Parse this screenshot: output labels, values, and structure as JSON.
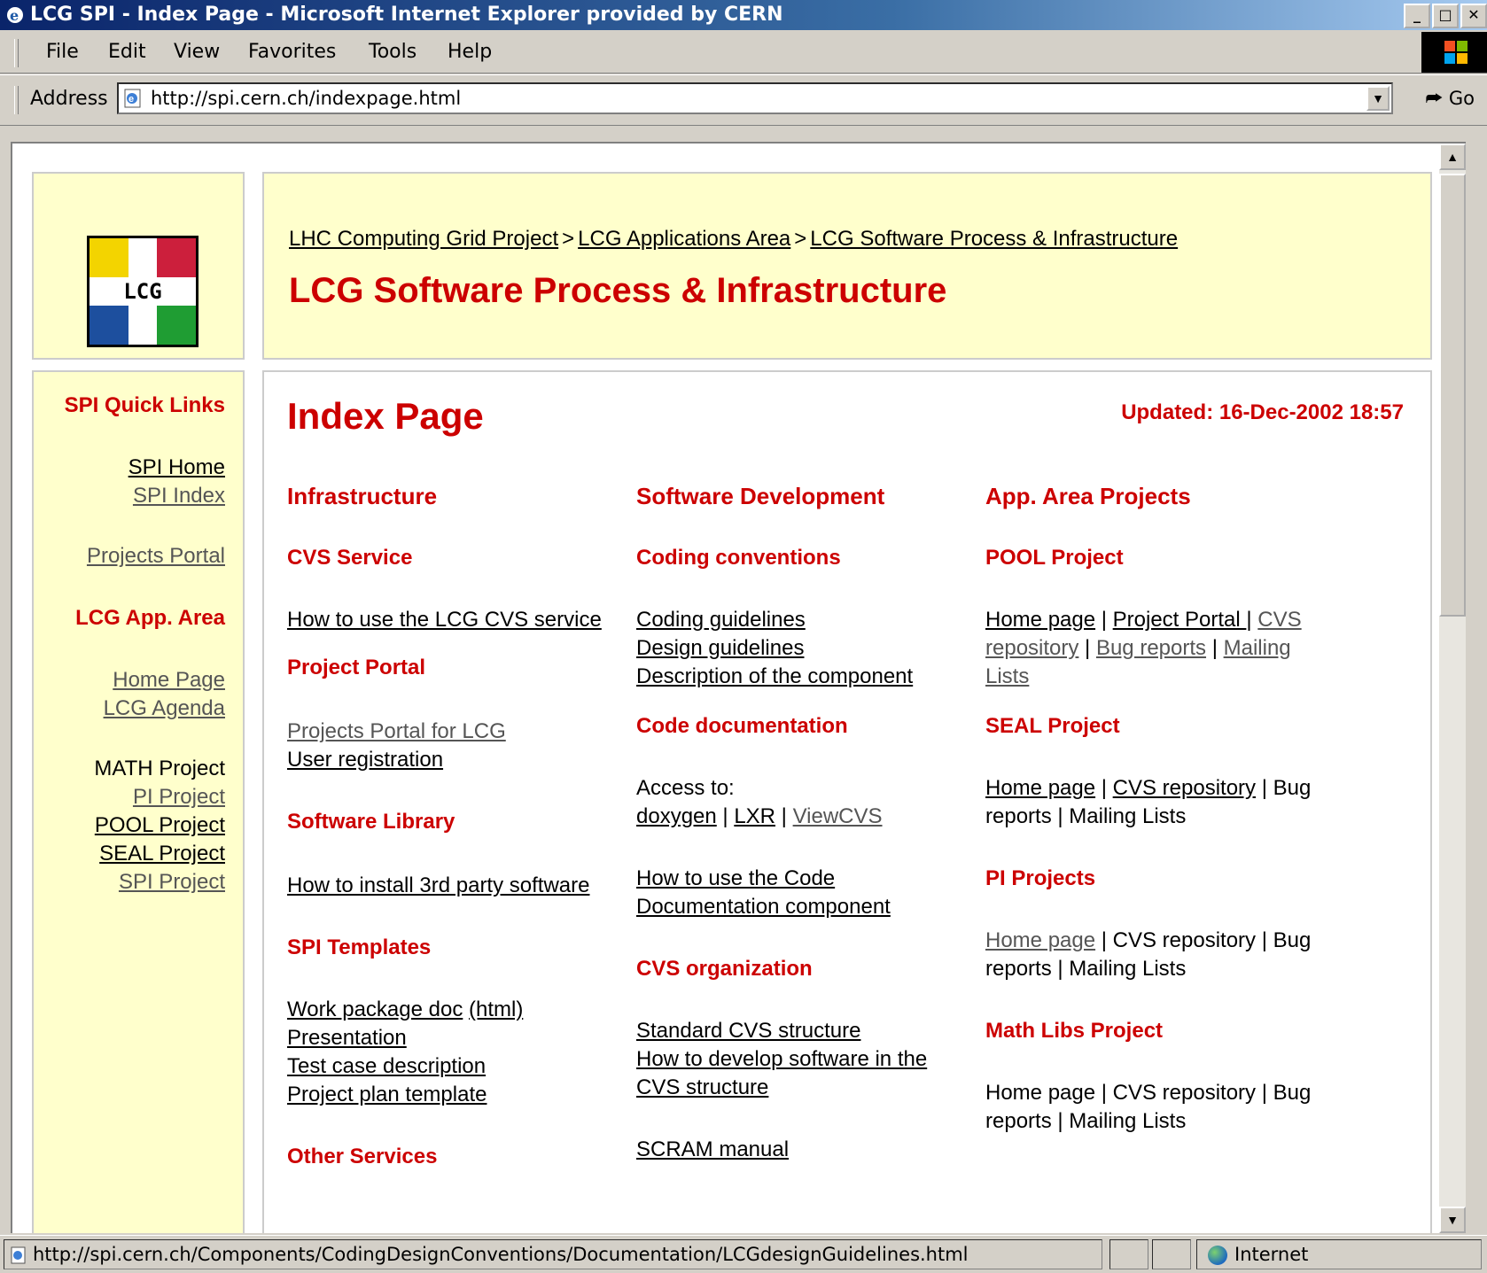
{
  "window": {
    "title": "LCG SPI - Index Page - Microsoft Internet Explorer provided by CERN",
    "min": "_",
    "max": "□",
    "close": "✕"
  },
  "menu": [
    "File",
    "Edit",
    "View",
    "Favorites",
    "Tools",
    "Help"
  ],
  "address": {
    "label": "Address",
    "url": "http://spi.cern.ch/indexpage.html",
    "go": "Go"
  },
  "header": {
    "breadcrumb": [
      "LHC Computing Grid Project",
      "LCG Applications Area",
      "LCG Software Process & Infrastructure"
    ],
    "separator": ">",
    "title": "LCG Software Process & Infrastructure",
    "logo_text": "LCG"
  },
  "sidebar": {
    "quick_links_heading": "SPI Quick Links",
    "spi_home": "SPI Home",
    "spi_index": "SPI Index",
    "projects_portal": "Projects Portal",
    "app_area_heading": "LCG App. Area",
    "home_page": "Home Page",
    "lcg_agenda": "LCG Agenda",
    "math_project": "MATH Project",
    "pi_project": "PI Project",
    "pool_project": "POOL Project",
    "seal_project": "SEAL Project",
    "spi_project": "SPI Project"
  },
  "main": {
    "title": "Index Page",
    "updated": "Updated: 16-Dec-2002 18:57",
    "col1": {
      "heading": "Infrastructure",
      "cvs_heading": "CVS Service",
      "cvs_link": "How to use the LCG CVS service",
      "portal_heading": "Project Portal",
      "portal_link1": "Projects Portal for LCG",
      "portal_link2": "User registration",
      "library_heading": "Software Library",
      "library_link": "How to install 3rd party software",
      "templates_heading": "SPI Templates",
      "tpl_work": "Work package doc",
      "tpl_html": "(html)",
      "tpl_presentation": "Presentation",
      "tpl_testcase": "Test case description",
      "tpl_plan": "Project plan template",
      "other_heading": "Other Services"
    },
    "col2": {
      "heading": "Software Development",
      "coding_heading": "Coding conventions",
      "coding_link1": "Coding guidelines",
      "coding_link2": "Design guidelines",
      "coding_link3": "Description of the component",
      "doc_heading": "Code documentation",
      "access_to": "Access to:",
      "doxygen": "doxygen",
      "lxr": "LXR",
      "viewcvs": "ViewCVS",
      "doc_link1": "How to use the Code",
      "doc_link2": "Documentation component",
      "cvsorg_heading": "CVS organization",
      "cvsorg_link1": "Standard CVS structure",
      "cvsorg_link2": "How to develop software in the",
      "cvsorg_link3": "CVS structure",
      "scram": "SCRAM manual"
    },
    "col3": {
      "heading": "App. Area Projects",
      "pool_heading": "POOL Project",
      "pool_home": "Home page",
      "pool_portal": "Project Portal ",
      "pool_cvs_a": "CVS",
      "pool_cvs_b": "repository",
      "pool_bugs": "Bug reports",
      "pool_mail_a": "Mailing",
      "pool_mail_b": "Lists",
      "seal_heading": "SEAL Project",
      "seal_home": "Home page",
      "seal_cvs": "CVS repository",
      "seal_rest_a": "| Bug",
      "seal_rest_b": "reports | Mailing Lists",
      "pi_heading": "PI Projects",
      "pi_home": "Home page",
      "pi_rest_a": "| CVS repository | Bug",
      "pi_rest_b": "reports | Mailing Lists",
      "math_heading": "Math Libs Project",
      "math_rest_a": "Home page | CVS repository | Bug",
      "math_rest_b": "reports | Mailing Lists"
    }
  },
  "status": {
    "text": "http://spi.cern.ch/Components/CodingDesignConventions/Documentation/LCGdesignGuidelines.html",
    "zone": "Internet"
  }
}
